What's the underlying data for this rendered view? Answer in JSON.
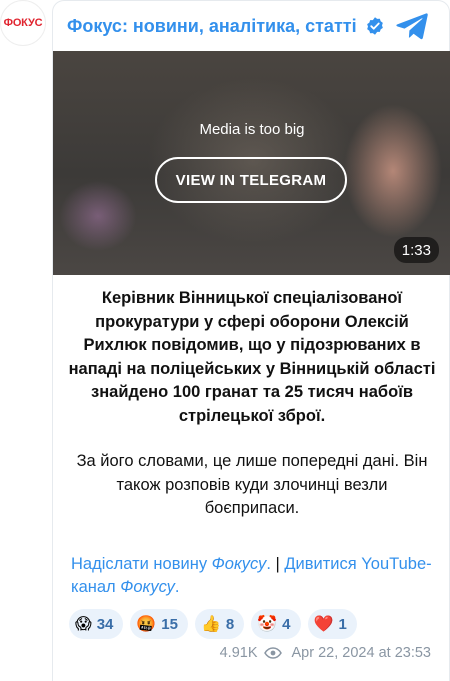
{
  "avatar": {
    "label": "ФОКУС"
  },
  "header": {
    "channel_name": "Фокус: новини, аналітика, статті"
  },
  "media": {
    "notice": "Media is too big",
    "button_label": "VIEW IN TELEGRAM",
    "duration": "1:33"
  },
  "post": {
    "paragraph1": "Керівник Вінницької спеціалізованої прокуратури у сфері оборони Олексій Рихлюк повідомив, що у підозрюваних в нападі на поліцейських у Вінницькій області знайдено 100 гранат та 25 тисяч набоїв стрілецької зброї.",
    "paragraph2": "За його словами, це лише попередні дані. Він також розповів куди злочинці везли боєприпаси."
  },
  "links": {
    "send_news_prefix": "Надіслати новину ",
    "send_news_italic": "Фокусу",
    "send_news_suffix": ".",
    "separator": " | ",
    "youtube_prefix": "Дивитися YouTube-канал ",
    "youtube_italic": "Фокусу",
    "youtube_suffix": "."
  },
  "reactions": [
    {
      "emoji": "😱",
      "count": "34",
      "icon": "screaming-face-icon"
    },
    {
      "emoji": "🤬",
      "count": "15",
      "icon": "cursing-face-icon"
    },
    {
      "emoji": "👍",
      "count": "8",
      "icon": "thumbs-up-icon"
    },
    {
      "emoji": "🤡",
      "count": "4",
      "icon": "clown-face-icon"
    },
    {
      "emoji": "❤️",
      "count": "1",
      "icon": "red-heart-icon"
    }
  ],
  "meta": {
    "views": "4.91K",
    "timestamp": "Apr 22, 2024 at 23:53"
  },
  "colors": {
    "accent": "#3390ec",
    "text": "#111111",
    "muted": "#8a96a3",
    "reaction_bg": "#eaf2fb",
    "brand_red": "#e0242f"
  }
}
